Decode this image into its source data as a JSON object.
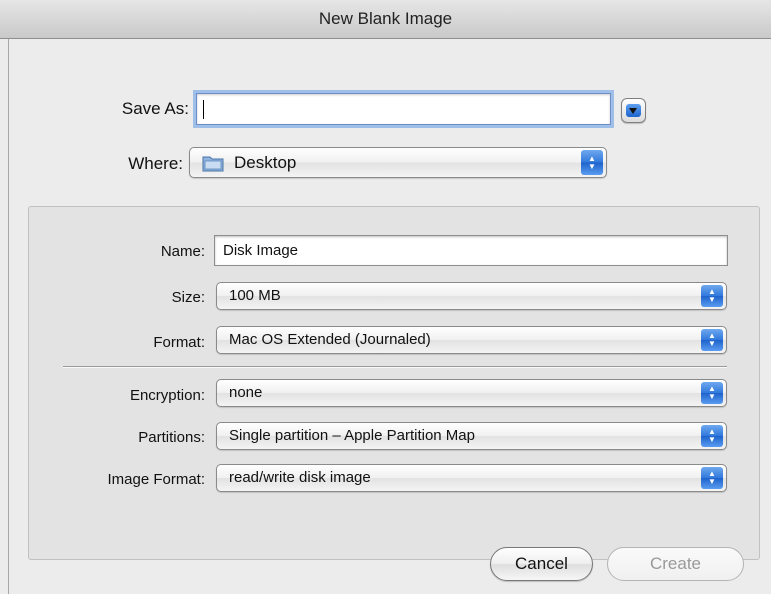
{
  "window": {
    "title": "New Blank Image"
  },
  "save_panel": {
    "save_as_label": "Save As:",
    "save_as_value": "",
    "where_label": "Where:",
    "where_value": "Desktop",
    "where_icon": "folder-icon",
    "disclosure_icon": "disclosure-triangle-down-icon"
  },
  "options": {
    "name": {
      "label": "Name:",
      "value": "Disk Image"
    },
    "size": {
      "label": "Size:",
      "value": "100 MB"
    },
    "format": {
      "label": "Format:",
      "value": "Mac OS Extended (Journaled)"
    },
    "encryption": {
      "label": "Encryption:",
      "value": "none"
    },
    "partitions": {
      "label": "Partitions:",
      "value": "Single partition – Apple Partition Map"
    },
    "image_format": {
      "label": "Image Format:",
      "value": "read/write disk image"
    }
  },
  "buttons": {
    "cancel": "Cancel",
    "create": "Create"
  },
  "colors": {
    "accent_blue": "#2f78dc",
    "focus_ring": "#9fbfe8",
    "disabled_text": "#9a9a9a"
  }
}
